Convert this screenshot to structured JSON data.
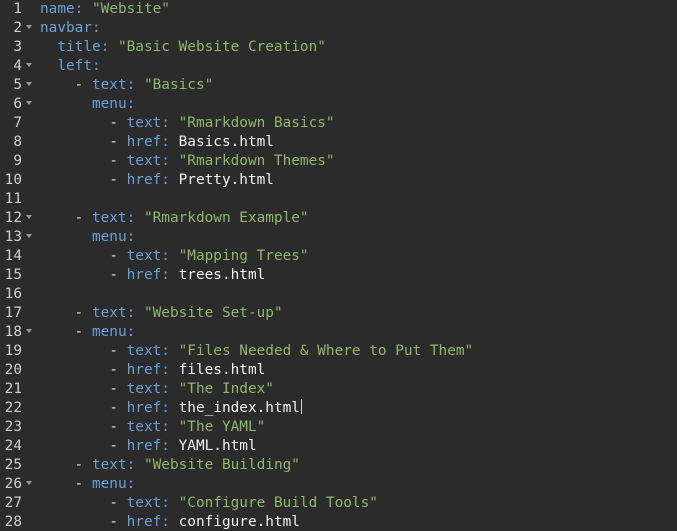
{
  "editor": {
    "lines": [
      {
        "num": "1",
        "fold": false,
        "indent": "",
        "dash": "",
        "key": "name:",
        "str": "\"Website\"",
        "val": "",
        "cursor": false
      },
      {
        "num": "2",
        "fold": true,
        "indent": "",
        "dash": "",
        "key": "navbar:",
        "str": "",
        "val": "",
        "cursor": false
      },
      {
        "num": "3",
        "fold": false,
        "indent": "  ",
        "dash": "",
        "key": "title:",
        "str": "\"Basic Website Creation\"",
        "val": "",
        "cursor": false
      },
      {
        "num": "4",
        "fold": true,
        "indent": "  ",
        "dash": "",
        "key": "left:",
        "str": "",
        "val": "",
        "cursor": false
      },
      {
        "num": "5",
        "fold": true,
        "indent": "    ",
        "dash": "- ",
        "key": "text:",
        "str": "\"Basics\"",
        "val": "",
        "cursor": false
      },
      {
        "num": "6",
        "fold": true,
        "indent": "      ",
        "dash": "",
        "key": "menu:",
        "str": "",
        "val": "",
        "cursor": false
      },
      {
        "num": "7",
        "fold": false,
        "indent": "        ",
        "dash": "- ",
        "key": "text:",
        "str": "\"Rmarkdown Basics\"",
        "val": "",
        "cursor": false
      },
      {
        "num": "8",
        "fold": false,
        "indent": "        ",
        "dash": "- ",
        "key": "href:",
        "str": "",
        "val": "Basics.html",
        "cursor": false
      },
      {
        "num": "9",
        "fold": false,
        "indent": "        ",
        "dash": "- ",
        "key": "text:",
        "str": "\"Rmarkdown Themes\"",
        "val": "",
        "cursor": false
      },
      {
        "num": "10",
        "fold": false,
        "indent": "        ",
        "dash": "- ",
        "key": "href:",
        "str": "",
        "val": "Pretty.html",
        "cursor": false
      },
      {
        "num": "11",
        "fold": false,
        "indent": "",
        "dash": "",
        "key": "",
        "str": "",
        "val": "",
        "cursor": false
      },
      {
        "num": "12",
        "fold": true,
        "indent": "    ",
        "dash": "- ",
        "key": "text:",
        "str": "\"Rmarkdown Example\"",
        "val": "",
        "cursor": false
      },
      {
        "num": "13",
        "fold": true,
        "indent": "      ",
        "dash": "",
        "key": "menu:",
        "str": "",
        "val": "",
        "cursor": false
      },
      {
        "num": "14",
        "fold": false,
        "indent": "        ",
        "dash": "- ",
        "key": "text:",
        "str": "\"Mapping Trees\"",
        "val": "",
        "cursor": false
      },
      {
        "num": "15",
        "fold": false,
        "indent": "        ",
        "dash": "- ",
        "key": "href:",
        "str": "",
        "val": "trees.html",
        "cursor": false
      },
      {
        "num": "16",
        "fold": false,
        "indent": "",
        "dash": "",
        "key": "",
        "str": "",
        "val": "",
        "cursor": false
      },
      {
        "num": "17",
        "fold": false,
        "indent": "    ",
        "dash": "- ",
        "key": "text:",
        "str": "\"Website Set-up\"",
        "val": "",
        "cursor": false
      },
      {
        "num": "18",
        "fold": true,
        "indent": "    ",
        "dash": "- ",
        "key": "menu:",
        "str": "",
        "val": "",
        "cursor": false
      },
      {
        "num": "19",
        "fold": false,
        "indent": "        ",
        "dash": "- ",
        "key": "text:",
        "str": "\"Files Needed & Where to Put Them\"",
        "val": "",
        "cursor": false
      },
      {
        "num": "20",
        "fold": false,
        "indent": "        ",
        "dash": "- ",
        "key": "href:",
        "str": "",
        "val": "files.html",
        "cursor": false
      },
      {
        "num": "21",
        "fold": false,
        "indent": "        ",
        "dash": "- ",
        "key": "text:",
        "str": "\"The Index\"",
        "val": "",
        "cursor": false
      },
      {
        "num": "22",
        "fold": false,
        "indent": "        ",
        "dash": "- ",
        "key": "href:",
        "str": "",
        "val": "the_index.html",
        "cursor": true
      },
      {
        "num": "23",
        "fold": false,
        "indent": "        ",
        "dash": "- ",
        "key": "text:",
        "str": "\"The YAML\"",
        "val": "",
        "cursor": false
      },
      {
        "num": "24",
        "fold": false,
        "indent": "        ",
        "dash": "- ",
        "key": "href:",
        "str": "",
        "val": "YAML.html",
        "cursor": false
      },
      {
        "num": "25",
        "fold": false,
        "indent": "    ",
        "dash": "- ",
        "key": "text:",
        "str": "\"Website Building\"",
        "val": "",
        "cursor": false
      },
      {
        "num": "26",
        "fold": true,
        "indent": "    ",
        "dash": "- ",
        "key": "menu:",
        "str": "",
        "val": "",
        "cursor": false
      },
      {
        "num": "27",
        "fold": false,
        "indent": "        ",
        "dash": "- ",
        "key": "text:",
        "str": "\"Configure Build Tools\"",
        "val": "",
        "cursor": false
      },
      {
        "num": "28",
        "fold": false,
        "indent": "        ",
        "dash": "- ",
        "key": "href:",
        "str": "",
        "val": "configure.html",
        "cursor": false
      }
    ]
  },
  "colors": {
    "background": "#2b2b2b",
    "key": "#6aa0d8",
    "string": "#8fb86a",
    "plain": "#f2f2f2",
    "line_number": "#cfcfcf"
  },
  "icons": {
    "fold": "chevron-down-icon"
  }
}
